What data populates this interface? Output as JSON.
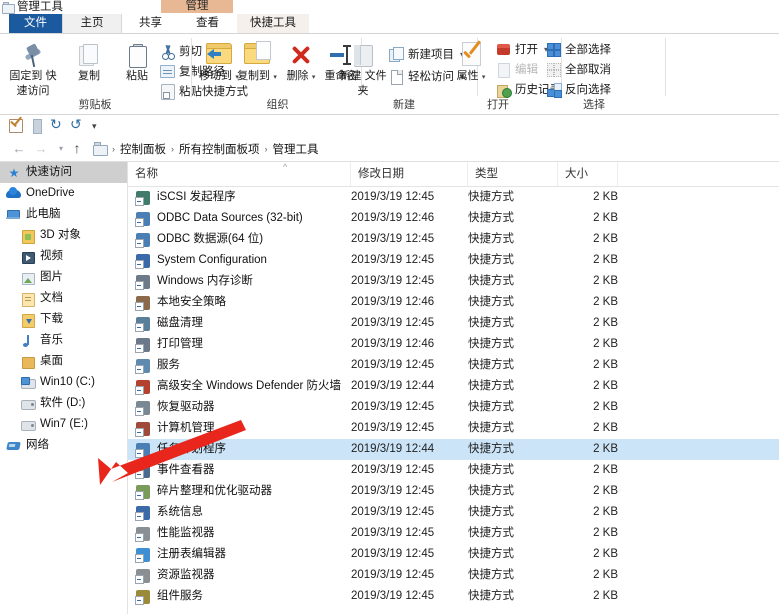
{
  "window": {
    "title": "管理工具",
    "contextual_tab": "管理"
  },
  "ribbon_tabs": [
    {
      "label": "文件",
      "name": "tab-file"
    },
    {
      "label": "主页",
      "name": "tab-home"
    },
    {
      "label": "共享",
      "name": "tab-share"
    },
    {
      "label": "查看",
      "name": "tab-view"
    },
    {
      "label": "快捷工具",
      "name": "tab-shortcut-tools"
    }
  ],
  "ribbon": {
    "clipboard": {
      "group_label": "剪贴板",
      "pin": "固定到\n快速访问",
      "pin_line1": "固定到",
      "pin_line2": "快速访问",
      "copy": "复制",
      "paste": "粘贴",
      "cut": "剪切",
      "copy_path": "复制路径",
      "paste_shortcut": "粘贴快捷方式"
    },
    "organize": {
      "group_label": "组织",
      "move_to": "移动到",
      "copy_to": "复制到",
      "delete": "删除",
      "rename": "重命名"
    },
    "new": {
      "group_label": "新建",
      "new_folder_line1": "新建",
      "new_folder_line2": "文件夹",
      "new_item": "新建项目",
      "easy_access": "轻松访问"
    },
    "open": {
      "group_label": "打开",
      "properties": "属性",
      "open": "打开",
      "edit": "编辑",
      "history": "历史记录"
    },
    "select": {
      "group_label": "选择",
      "select_all": "全部选择",
      "select_none": "全部取消",
      "invert_selection": "反向选择"
    }
  },
  "quick_access_toolbar": {
    "save": "save-icon",
    "properties": "properties-icon",
    "redo": "↻",
    "undo": "↺",
    "more": "▾"
  },
  "address_bar": {
    "back": "←",
    "forward": "→",
    "recent": "▾",
    "up": "↑",
    "breadcrumbs": [
      "控制面板",
      "所有控制面板项",
      "管理工具"
    ],
    "separator": "›"
  },
  "nav_pane": {
    "items": [
      {
        "label": "快速访问",
        "icon": "star-icon",
        "indent": 0,
        "selected": true
      },
      {
        "label": "OneDrive",
        "icon": "cloud-icon",
        "indent": 0,
        "selected": false
      },
      {
        "label": "此电脑",
        "icon": "computer-icon",
        "indent": 0,
        "selected": false
      },
      {
        "label": "3D 对象",
        "icon": "3d-objects-icon",
        "indent": 1,
        "selected": false
      },
      {
        "label": "视频",
        "icon": "videos-icon",
        "indent": 1,
        "selected": false
      },
      {
        "label": "图片",
        "icon": "pictures-icon",
        "indent": 1,
        "selected": false
      },
      {
        "label": "文档",
        "icon": "documents-icon",
        "indent": 1,
        "selected": false
      },
      {
        "label": "下载",
        "icon": "downloads-icon",
        "indent": 1,
        "selected": false
      },
      {
        "label": "音乐",
        "icon": "music-icon",
        "indent": 1,
        "selected": false
      },
      {
        "label": "桌面",
        "icon": "desktop-icon",
        "indent": 1,
        "selected": false
      },
      {
        "label": "Win10 (C:)",
        "icon": "system-drive-icon",
        "indent": 1,
        "selected": false
      },
      {
        "label": "软件 (D:)",
        "icon": "drive-icon",
        "indent": 1,
        "selected": false
      },
      {
        "label": "Win7 (E:)",
        "icon": "drive-icon",
        "indent": 1,
        "selected": false
      },
      {
        "label": "网络",
        "icon": "network-icon",
        "indent": 0,
        "selected": false
      }
    ]
  },
  "file_list": {
    "columns": [
      {
        "label": "名称",
        "key": "name"
      },
      {
        "label": "修改日期",
        "key": "date"
      },
      {
        "label": "类型",
        "key": "type"
      },
      {
        "label": "大小",
        "key": "size"
      }
    ],
    "sort_indicator": "^",
    "rows": [
      {
        "name": "iSCSI 发起程序",
        "date": "2019/3/19 12:45",
        "type": "快捷方式",
        "size": "2 KB",
        "icon": "iscsi-icon",
        "color": "#3f7a6a",
        "selected": false
      },
      {
        "name": "ODBC Data Sources (32-bit)",
        "date": "2019/3/19 12:46",
        "type": "快捷方式",
        "size": "2 KB",
        "icon": "odbc-icon",
        "color": "#4a7fb5",
        "selected": false
      },
      {
        "name": "ODBC 数据源(64 位)",
        "date": "2019/3/19 12:45",
        "type": "快捷方式",
        "size": "2 KB",
        "icon": "odbc-icon",
        "color": "#4a7fb5",
        "selected": false
      },
      {
        "name": "System Configuration",
        "date": "2019/3/19 12:45",
        "type": "快捷方式",
        "size": "2 KB",
        "icon": "msconfig-icon",
        "color": "#3a6ba8",
        "selected": false
      },
      {
        "name": "Windows 内存诊断",
        "date": "2019/3/19 12:45",
        "type": "快捷方式",
        "size": "2 KB",
        "icon": "memory-diagnostic-icon",
        "color": "#6d7b88",
        "selected": false
      },
      {
        "name": "本地安全策略",
        "date": "2019/3/19 12:46",
        "type": "快捷方式",
        "size": "2 KB",
        "icon": "local-security-policy-icon",
        "color": "#8a6a4a",
        "selected": false
      },
      {
        "name": "磁盘清理",
        "date": "2019/3/19 12:45",
        "type": "快捷方式",
        "size": "2 KB",
        "icon": "disk-cleanup-icon",
        "color": "#5a7f9a",
        "selected": false
      },
      {
        "name": "打印管理",
        "date": "2019/3/19 12:46",
        "type": "快捷方式",
        "size": "2 KB",
        "icon": "print-management-icon",
        "color": "#6a7a8a",
        "selected": false
      },
      {
        "name": "服务",
        "date": "2019/3/19 12:45",
        "type": "快捷方式",
        "size": "2 KB",
        "icon": "services-icon",
        "color": "#5f8ab0",
        "selected": false
      },
      {
        "name": "高级安全 Windows Defender 防火墙",
        "date": "2019/3/19 12:44",
        "type": "快捷方式",
        "size": "2 KB",
        "icon": "firewall-icon",
        "color": "#b5422f",
        "selected": false
      },
      {
        "name": "恢复驱动器",
        "date": "2019/3/19 12:45",
        "type": "快捷方式",
        "size": "2 KB",
        "icon": "recovery-drive-icon",
        "color": "#7a8894",
        "selected": false
      },
      {
        "name": "计算机管理",
        "date": "2019/3/19 12:45",
        "type": "快捷方式",
        "size": "2 KB",
        "icon": "computer-management-icon",
        "color": "#a04a3a",
        "selected": false
      },
      {
        "name": "任务计划程序",
        "date": "2019/3/19 12:44",
        "type": "快捷方式",
        "size": "2 KB",
        "icon": "task-scheduler-icon",
        "color": "#4a7fb5",
        "selected": true
      },
      {
        "name": "事件查看器",
        "date": "2019/3/19 12:45",
        "type": "快捷方式",
        "size": "2 KB",
        "icon": "event-viewer-icon",
        "color": "#4a6b8f",
        "selected": false
      },
      {
        "name": "碎片整理和优化驱动器",
        "date": "2019/3/19 12:45",
        "type": "快捷方式",
        "size": "2 KB",
        "icon": "defragment-icon",
        "color": "#7a9b5a",
        "selected": false
      },
      {
        "name": "系统信息",
        "date": "2019/3/19 12:45",
        "type": "快捷方式",
        "size": "2 KB",
        "icon": "system-info-icon",
        "color": "#3a6ba8",
        "selected": false
      },
      {
        "name": "性能监视器",
        "date": "2019/3/19 12:45",
        "type": "快捷方式",
        "size": "2 KB",
        "icon": "performance-monitor-icon",
        "color": "#8a8f94",
        "selected": false
      },
      {
        "name": "注册表编辑器",
        "date": "2019/3/19 12:45",
        "type": "快捷方式",
        "size": "2 KB",
        "icon": "registry-editor-icon",
        "color": "#3f8fd4",
        "selected": false
      },
      {
        "name": "资源监视器",
        "date": "2019/3/19 12:45",
        "type": "快捷方式",
        "size": "2 KB",
        "icon": "resource-monitor-icon",
        "color": "#8a8f94",
        "selected": false
      },
      {
        "name": "组件服务",
        "date": "2019/3/19 12:45",
        "type": "快捷方式",
        "size": "2 KB",
        "icon": "component-services-icon",
        "color": "#9a8a3a",
        "selected": false
      }
    ]
  },
  "annotation": {
    "type": "red-arrow",
    "color": "#e8261b",
    "points_to": "任务计划程序"
  }
}
